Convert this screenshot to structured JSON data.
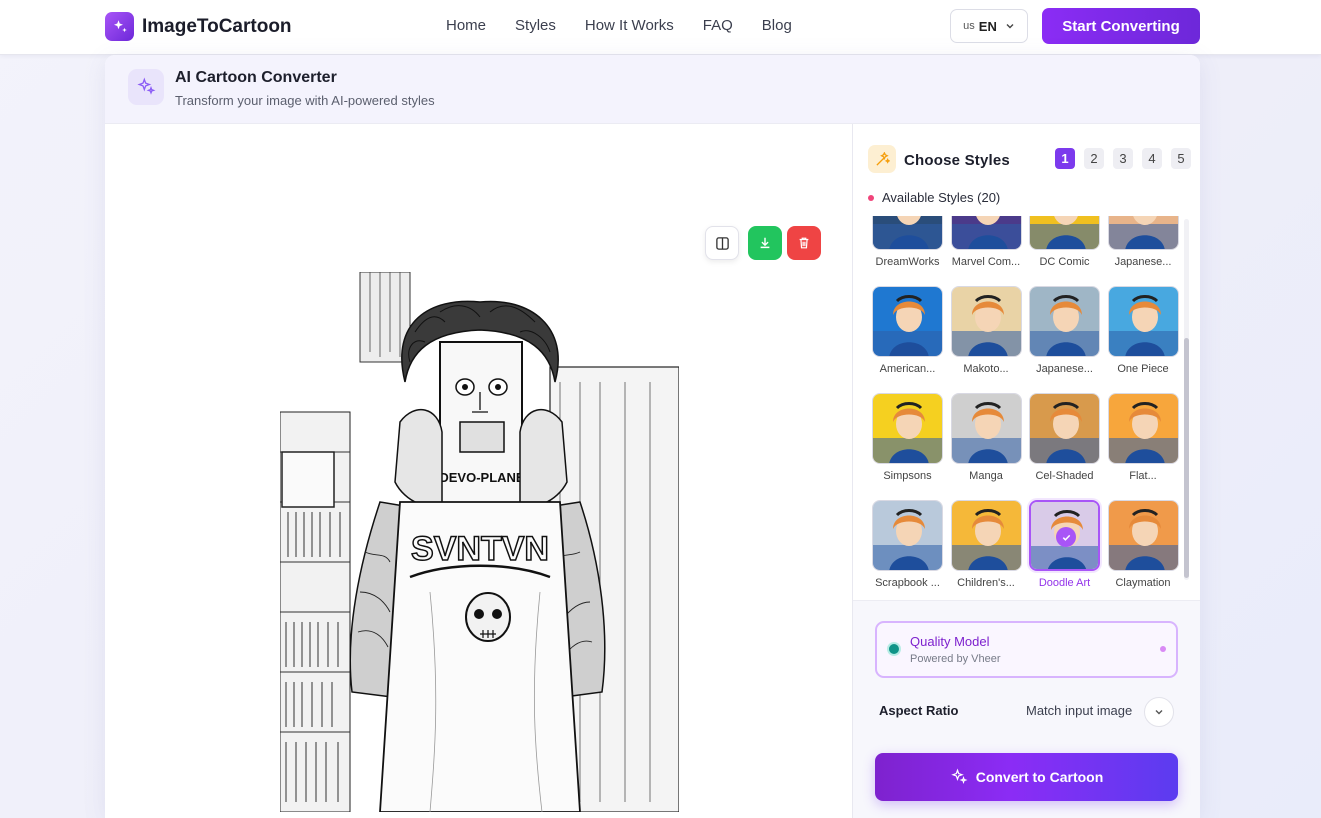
{
  "nav": {
    "brand": "ImageToCartoon",
    "links": [
      "Home",
      "Styles",
      "How It Works",
      "FAQ",
      "Blog"
    ],
    "lang_flag": "us",
    "lang_code": "EN",
    "cta": "Start Converting"
  },
  "header": {
    "title": "AI Cartoon Converter",
    "subtitle": "Transform your image with AI-powered styles"
  },
  "styles_panel": {
    "title": "Choose Styles",
    "pages": [
      "1",
      "2",
      "3",
      "4",
      "5"
    ],
    "active_page": "1",
    "available_label": "Available Styles (20)",
    "styles": [
      {
        "label": "DreamWorks",
        "bg": "#2a4d7a"
      },
      {
        "label": "Marvel Com...",
        "bg": "#4b3a8a"
      },
      {
        "label": "DC Comic",
        "bg": "#f0c020"
      },
      {
        "label": "Japanese...",
        "bg": "#e8b48a"
      },
      {
        "label": "American...",
        "bg": "#1f78d1"
      },
      {
        "label": "Makoto...",
        "bg": "#e9d3a6"
      },
      {
        "label": "Japanese...",
        "bg": "#9fb6c6"
      },
      {
        "label": "One Piece",
        "bg": "#48a8e0"
      },
      {
        "label": "Simpsons",
        "bg": "#f5d020"
      },
      {
        "label": "Manga",
        "bg": "#cfcfcf"
      },
      {
        "label": "Cel-Shaded",
        "bg": "#d89a4c"
      },
      {
        "label": "Flat...",
        "bg": "#f7a63c"
      },
      {
        "label": "Scrapbook ...",
        "bg": "#b9c9db"
      },
      {
        "label": "Children's...",
        "bg": "#f5b839"
      },
      {
        "label": "Doodle Art",
        "bg": "#d9cbe8",
        "selected": true
      },
      {
        "label": "Claymation",
        "bg": "#f09a4a"
      }
    ]
  },
  "model": {
    "name": "Quality Model",
    "sub": "Powered by Vheer"
  },
  "aspect": {
    "label": "Aspect Ratio",
    "value": "Match input image"
  },
  "convert_label": "Convert to Cartoon",
  "colors": {
    "accent": "#7c3aed",
    "download": "#22c55e",
    "delete": "#ef4444"
  }
}
